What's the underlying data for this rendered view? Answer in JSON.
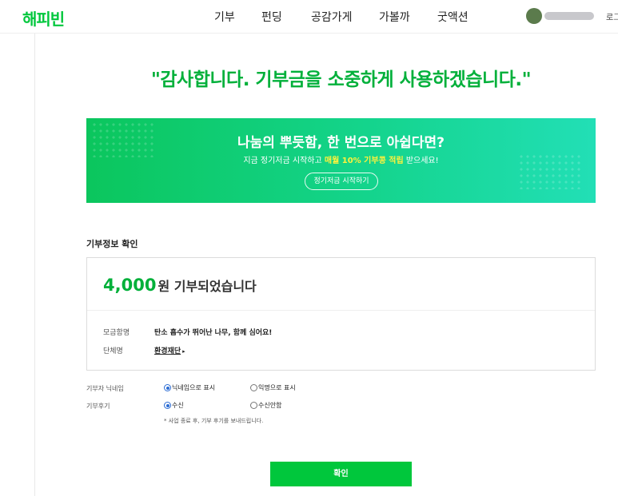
{
  "header": {
    "logo": "해피빈",
    "nav": [
      "기부",
      "펀딩",
      "공감가게",
      "가볼까",
      "굿액션"
    ],
    "user_name": "",
    "login": "로그"
  },
  "thanks_message": "\"감사합니다. 기부금을 소중하게 사용하겠습니다.\"",
  "banner": {
    "title": "나눔의 뿌듯함, 한 번으로 아쉽다면?",
    "sub_before": "지금 정기저금 시작하고 ",
    "sub_highlight": "매월 10% 기부콩 적립",
    "sub_after": " 받으세요!",
    "button": "정기저금 시작하기"
  },
  "donation_info": {
    "section_title": "기부정보 확인",
    "amount": "4,000",
    "amount_suffix": "원 기부되었습니다",
    "rows": [
      {
        "label": "모금함명",
        "value": "탄소 흡수가 뛰어난 나무, 함께 심어요!"
      },
      {
        "label": "단체명",
        "value": "환경재단"
      }
    ]
  },
  "options": {
    "nickname_label": "기부자 닉네임",
    "nickname_choices": [
      "닉네임으로 표시",
      "익명으로 표시"
    ],
    "nickname_selected": 0,
    "review_label": "기부후기",
    "review_choices": [
      "수신",
      "수신안함"
    ],
    "review_selected": 0,
    "note": "* 사업 종료 후, 기부 후기를 보내드립니다."
  },
  "confirm_button": "확인",
  "colors": {
    "brand": "#00c73c",
    "banner_start": "#0bc65d",
    "banner_end": "#22dfb6",
    "highlight": "#fff23c"
  }
}
